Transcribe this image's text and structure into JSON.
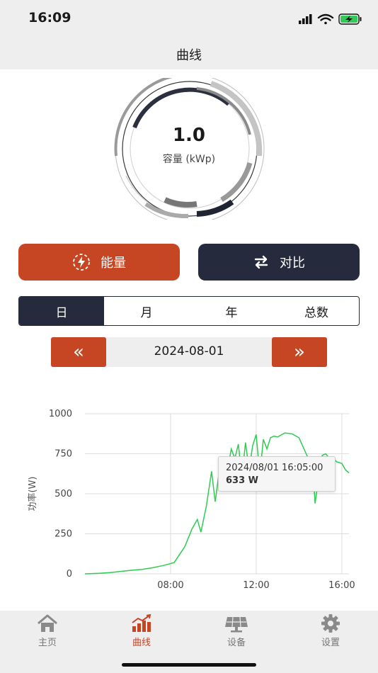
{
  "status_bar": {
    "time": "16:09"
  },
  "nav": {
    "title": "曲线"
  },
  "capacity": {
    "value": "1.0",
    "label": "容量 (kWp)"
  },
  "mode_buttons": {
    "energy": "能量",
    "compare": "对比"
  },
  "period_tabs": [
    {
      "label": "日",
      "active": true
    },
    {
      "label": "月",
      "active": false
    },
    {
      "label": "年",
      "active": false
    },
    {
      "label": "总数",
      "active": false
    }
  ],
  "date_selector": {
    "prev": "«",
    "next": "»",
    "date": "2024-08-01"
  },
  "chart_data": {
    "type": "line",
    "ylabel": "功率(W)",
    "xlabel": "",
    "ylim": [
      0,
      1000
    ],
    "yticks": [
      "0",
      "250",
      "500",
      "750",
      "1000"
    ],
    "xticks": [
      "08:00",
      "12:00",
      "16:00"
    ],
    "grid": true,
    "color": "#2ecc52",
    "series": [
      {
        "x": [
          "04:00",
          "04:40",
          "05:10",
          "05:40",
          "06:10",
          "06:40",
          "07:10",
          "07:40",
          "08:10",
          "08:40",
          "09:00",
          "09:15",
          "09:25",
          "09:40",
          "09:55",
          "10:05",
          "10:20",
          "10:35",
          "10:50",
          "11:00",
          "11:10",
          "11:20",
          "11:30",
          "11:40",
          "11:50",
          "12:00",
          "12:10",
          "12:20",
          "12:30",
          "12:40",
          "12:50",
          "13:00",
          "13:20",
          "13:40",
          "14:00",
          "14:20",
          "14:30",
          "14:40",
          "14:45",
          "14:55",
          "15:05",
          "15:15",
          "15:25",
          "15:35",
          "15:45",
          "16:00",
          "16:10",
          "16:20"
        ],
        "values": [
          0,
          3,
          8,
          15,
          22,
          28,
          38,
          52,
          70,
          170,
          280,
          340,
          260,
          420,
          640,
          450,
          700,
          590,
          780,
          720,
          810,
          600,
          820,
          650,
          800,
          870,
          620,
          840,
          780,
          850,
          860,
          855,
          880,
          875,
          850,
          750,
          700,
          620,
          440,
          600,
          740,
          750,
          720,
          730,
          700,
          690,
          650,
          630
        ]
      }
    ],
    "tooltip": {
      "time": "2024/08/01 16:05:00",
      "value": "633 W"
    }
  },
  "tab_bar": [
    {
      "label": "主页",
      "icon": "home-icon",
      "active": false
    },
    {
      "label": "曲线",
      "icon": "chart-icon",
      "active": true
    },
    {
      "label": "设备",
      "icon": "solar-panel-icon",
      "active": false
    },
    {
      "label": "设置",
      "icon": "gear-icon",
      "active": false
    }
  ],
  "colors": {
    "accent": "#c64523",
    "dark": "#252b3d",
    "line": "#2ecc52",
    "bar_bg": "#eeeeee"
  }
}
